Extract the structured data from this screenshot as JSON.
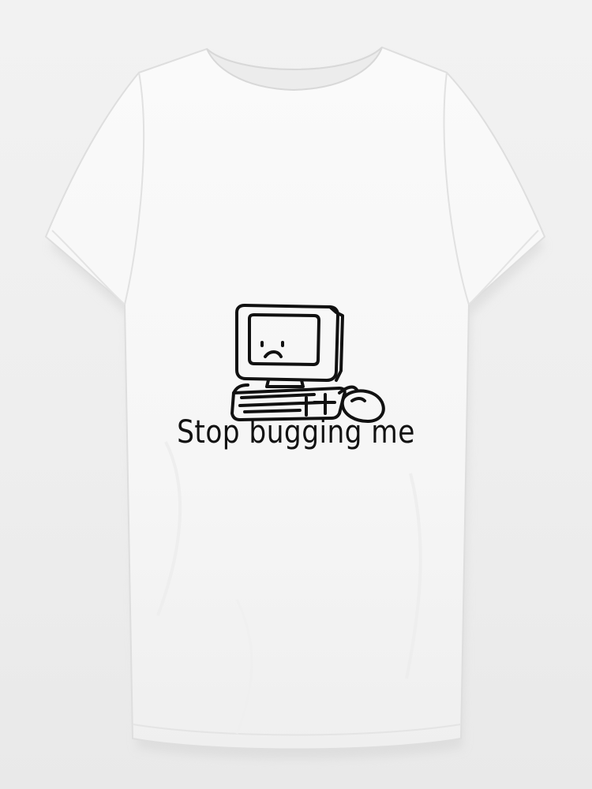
{
  "product": {
    "name": "t-shirt",
    "shirt_color": "#f7f7f7",
    "background_color": "#eeeeee",
    "print": {
      "illustration": "sad-computer-icon",
      "text": "Stop bugging me",
      "ink_color": "#111111"
    }
  }
}
